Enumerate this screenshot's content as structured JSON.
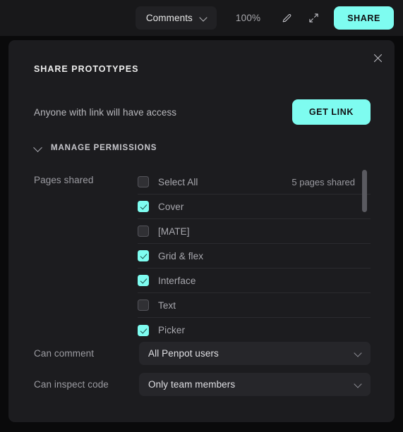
{
  "toolbar": {
    "comments_label": "Comments",
    "comments_chevron_icon": "chevron-down-icon",
    "zoom_level": "100%",
    "pencil_icon": "pencil-icon",
    "fullscreen_icon": "expand-arrows-icon",
    "share_label": "SHARE"
  },
  "modal": {
    "title": "SHARE PROTOTYPES",
    "close_icon": "close-icon",
    "link_text": "Anyone with link will have access",
    "get_link_label": "GET LINK",
    "manage_permissions_label": "MANAGE PERMISSIONS",
    "manage_chevron_icon": "chevron-down-icon",
    "pages_shared_label": "Pages shared",
    "pages_count_text": "5 pages shared",
    "pages": [
      {
        "label": "Select All",
        "checked": false
      },
      {
        "label": "Cover",
        "checked": true
      },
      {
        "label": "[MATE]",
        "checked": false
      },
      {
        "label": "Grid & flex",
        "checked": true
      },
      {
        "label": "Interface",
        "checked": true
      },
      {
        "label": "Text",
        "checked": false
      },
      {
        "label": "Picker",
        "checked": true
      }
    ],
    "can_comment_label": "Can comment",
    "can_comment_value": "All Penpot users",
    "can_inspect_label": "Can inspect code",
    "can_inspect_value": "Only team members",
    "select_chevron_icon": "chevron-down-icon"
  },
  "colors": {
    "accent": "#7efcf0",
    "app_bg": "#0a0a0b",
    "toolbar_bg": "#18181a",
    "modal_bg": "#1c1c1f",
    "select_bg": "#26262a",
    "divider": "#2b2b2f"
  }
}
